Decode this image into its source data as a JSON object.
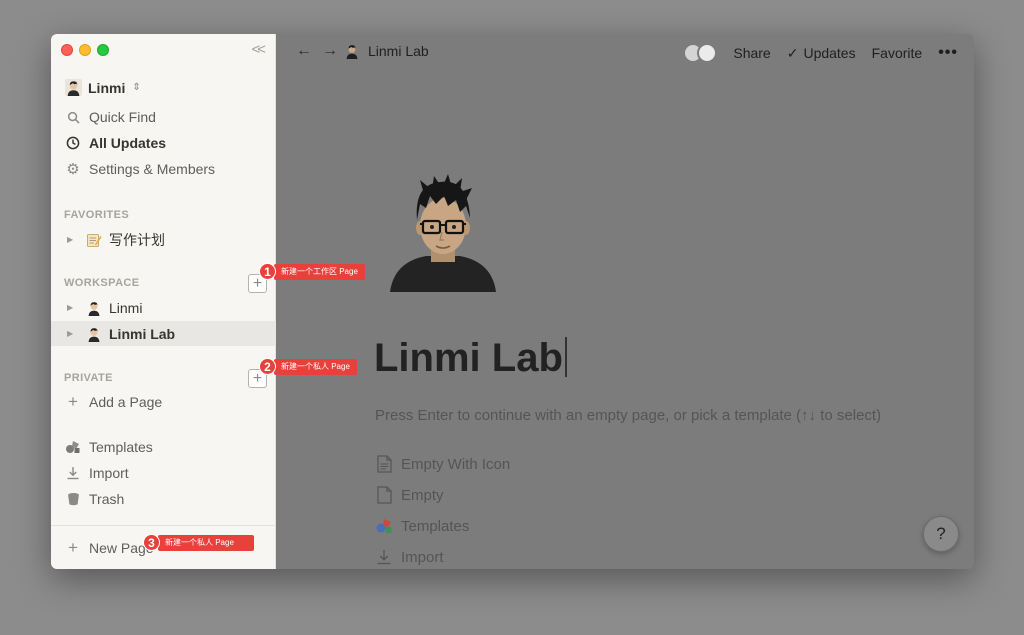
{
  "sidebar": {
    "workspace_name": "Linmi",
    "nav": [
      {
        "label": "Quick Find",
        "icon": "search-icon"
      },
      {
        "label": "All Updates",
        "icon": "clock-icon"
      },
      {
        "label": "Settings & Members",
        "icon": "gear-icon"
      }
    ],
    "favorites": {
      "header": "FAVORITES",
      "items": [
        {
          "label": "写作计划",
          "icon": "memo-icon"
        }
      ]
    },
    "workspace": {
      "header": "WORKSPACE",
      "items": [
        {
          "label": "Linmi",
          "icon": "avatar-icon"
        },
        {
          "label": "Linmi Lab",
          "icon": "avatar-icon"
        }
      ]
    },
    "private": {
      "header": "PRIVATE",
      "add_page": "Add a Page"
    },
    "bottom": [
      {
        "label": "Templates",
        "icon": "templates-icon"
      },
      {
        "label": "Import",
        "icon": "import-icon"
      },
      {
        "label": "Trash",
        "icon": "trash-icon"
      }
    ],
    "new_page": "New Page"
  },
  "topbar": {
    "breadcrumb": "Linmi Lab",
    "share": "Share",
    "updates": "Updates",
    "favorite": "Favorite"
  },
  "page": {
    "title": "Linmi Lab",
    "hint": "Press Enter to continue with an empty page, or pick a template (↑↓ to select)",
    "options": [
      {
        "label": "Empty With Icon",
        "icon": "doc-icon"
      },
      {
        "label": "Empty",
        "icon": "blank-doc-icon"
      },
      {
        "label": "Templates",
        "icon": "templates-icon"
      },
      {
        "label": "Import",
        "icon": "import-icon"
      }
    ],
    "help": "?"
  },
  "annotations": [
    {
      "num": "1",
      "text": "新建一个工作区 Page"
    },
    {
      "num": "2",
      "text": "新建一个私人 Page"
    },
    {
      "num": "3",
      "text": "新建一个私人 Page"
    }
  ],
  "colors": {
    "annotation": "#e8403a",
    "sidebar_bg": "#f7f6f3"
  }
}
